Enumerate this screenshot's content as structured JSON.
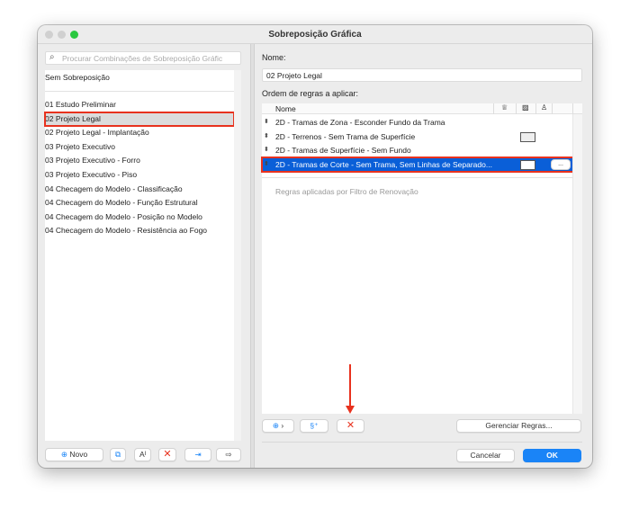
{
  "window": {
    "title": "Sobreposição Gráfica"
  },
  "left": {
    "search_placeholder": "Procurar Combinações de Sobreposição Gráfic",
    "none_item": "Sem Sobreposição",
    "items": [
      "01 Estudo Preliminar",
      "02 Projeto Legal",
      "02 Projeto Legal - Implantação",
      "03 Projeto Executivo",
      "03 Projeto Executivo - Forro",
      "03 Projeto Executivo - Piso",
      "04 Checagem do Modelo - Classificação",
      "04 Checagem do Modelo - Função Estrutural",
      "04 Checagem do Modelo - Posição no Modelo",
      "04 Checagem do Modelo - Resistência ao Fogo"
    ],
    "selected_index": 1,
    "new_label": "Novo"
  },
  "right": {
    "name_label": "Nome:",
    "name_value": "02 Projeto Legal",
    "rules_label": "Ordem de regras a aplicar:",
    "column_name": "Nome",
    "rules": [
      {
        "name": "2D - Tramas de Zona - Esconder Fundo da Trama",
        "swatch": null
      },
      {
        "name": "2D - Terrenos - Sem Trama de Superfície",
        "swatch": "#eeeeee"
      },
      {
        "name": "2D - Tramas de Superfície - Sem Fundo",
        "swatch": null
      },
      {
        "name": "2D - Tramas de Corte - Sem Trama, Sem Linhas de Separado...",
        "swatch": "#ffffff",
        "selected": true
      }
    ],
    "more_label": "...",
    "renovation_label": "Regras aplicadas por Filtro de Renovação",
    "manage_label": "Gerenciar Regras...",
    "cancel_label": "Cancelar",
    "ok_label": "OK"
  },
  "colors": {
    "accent": "#0a5fd8",
    "highlight": "#e8321e",
    "ok": "#1a84f7"
  }
}
